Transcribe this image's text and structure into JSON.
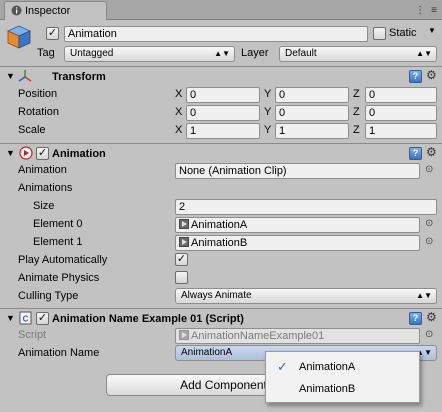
{
  "window": {
    "tab_label": "Inspector",
    "menu_icon": "⋮",
    "close_icon": "≡"
  },
  "gameobject": {
    "active": true,
    "name": "Animation",
    "static_label": "Static",
    "static_checked": false,
    "tag_label": "Tag",
    "tag_value": "Untagged",
    "layer_label": "Layer",
    "layer_value": "Default"
  },
  "transform": {
    "title": "Transform",
    "rows": [
      {
        "label": "Position",
        "x": "0",
        "y": "0",
        "z": "0"
      },
      {
        "label": "Rotation",
        "x": "0",
        "y": "0",
        "z": "0"
      },
      {
        "label": "Scale",
        "x": "1",
        "y": "1",
        "z": "1"
      }
    ],
    "axis_x": "X",
    "axis_y": "Y",
    "axis_z": "Z"
  },
  "animation": {
    "title": "Animation",
    "enabled": true,
    "animation_label": "Animation",
    "animation_value": "None (Animation Clip)",
    "animations_label": "Animations",
    "size_label": "Size",
    "size_value": "2",
    "elements": [
      {
        "label": "Element 0",
        "value": "AnimationA"
      },
      {
        "label": "Element 1",
        "value": "AnimationB"
      }
    ],
    "play_auto_label": "Play Automatically",
    "play_auto": true,
    "animate_physics_label": "Animate Physics",
    "animate_physics": false,
    "culling_label": "Culling Type",
    "culling_value": "Always Animate"
  },
  "script_component": {
    "title": "Animation Name Example 01 (Script)",
    "enabled": true,
    "script_label": "Script",
    "script_value": "AnimationNameExample01",
    "anim_name_label": "Animation Name",
    "anim_name_value": "AnimationA"
  },
  "add_component_label": "Add Component",
  "dropdown": {
    "items": [
      {
        "label": "AnimationA",
        "checked": true
      },
      {
        "label": "AnimationB",
        "checked": false
      }
    ]
  },
  "colors": {
    "background": "#c2c2c2",
    "accent": "#2a66c8"
  }
}
